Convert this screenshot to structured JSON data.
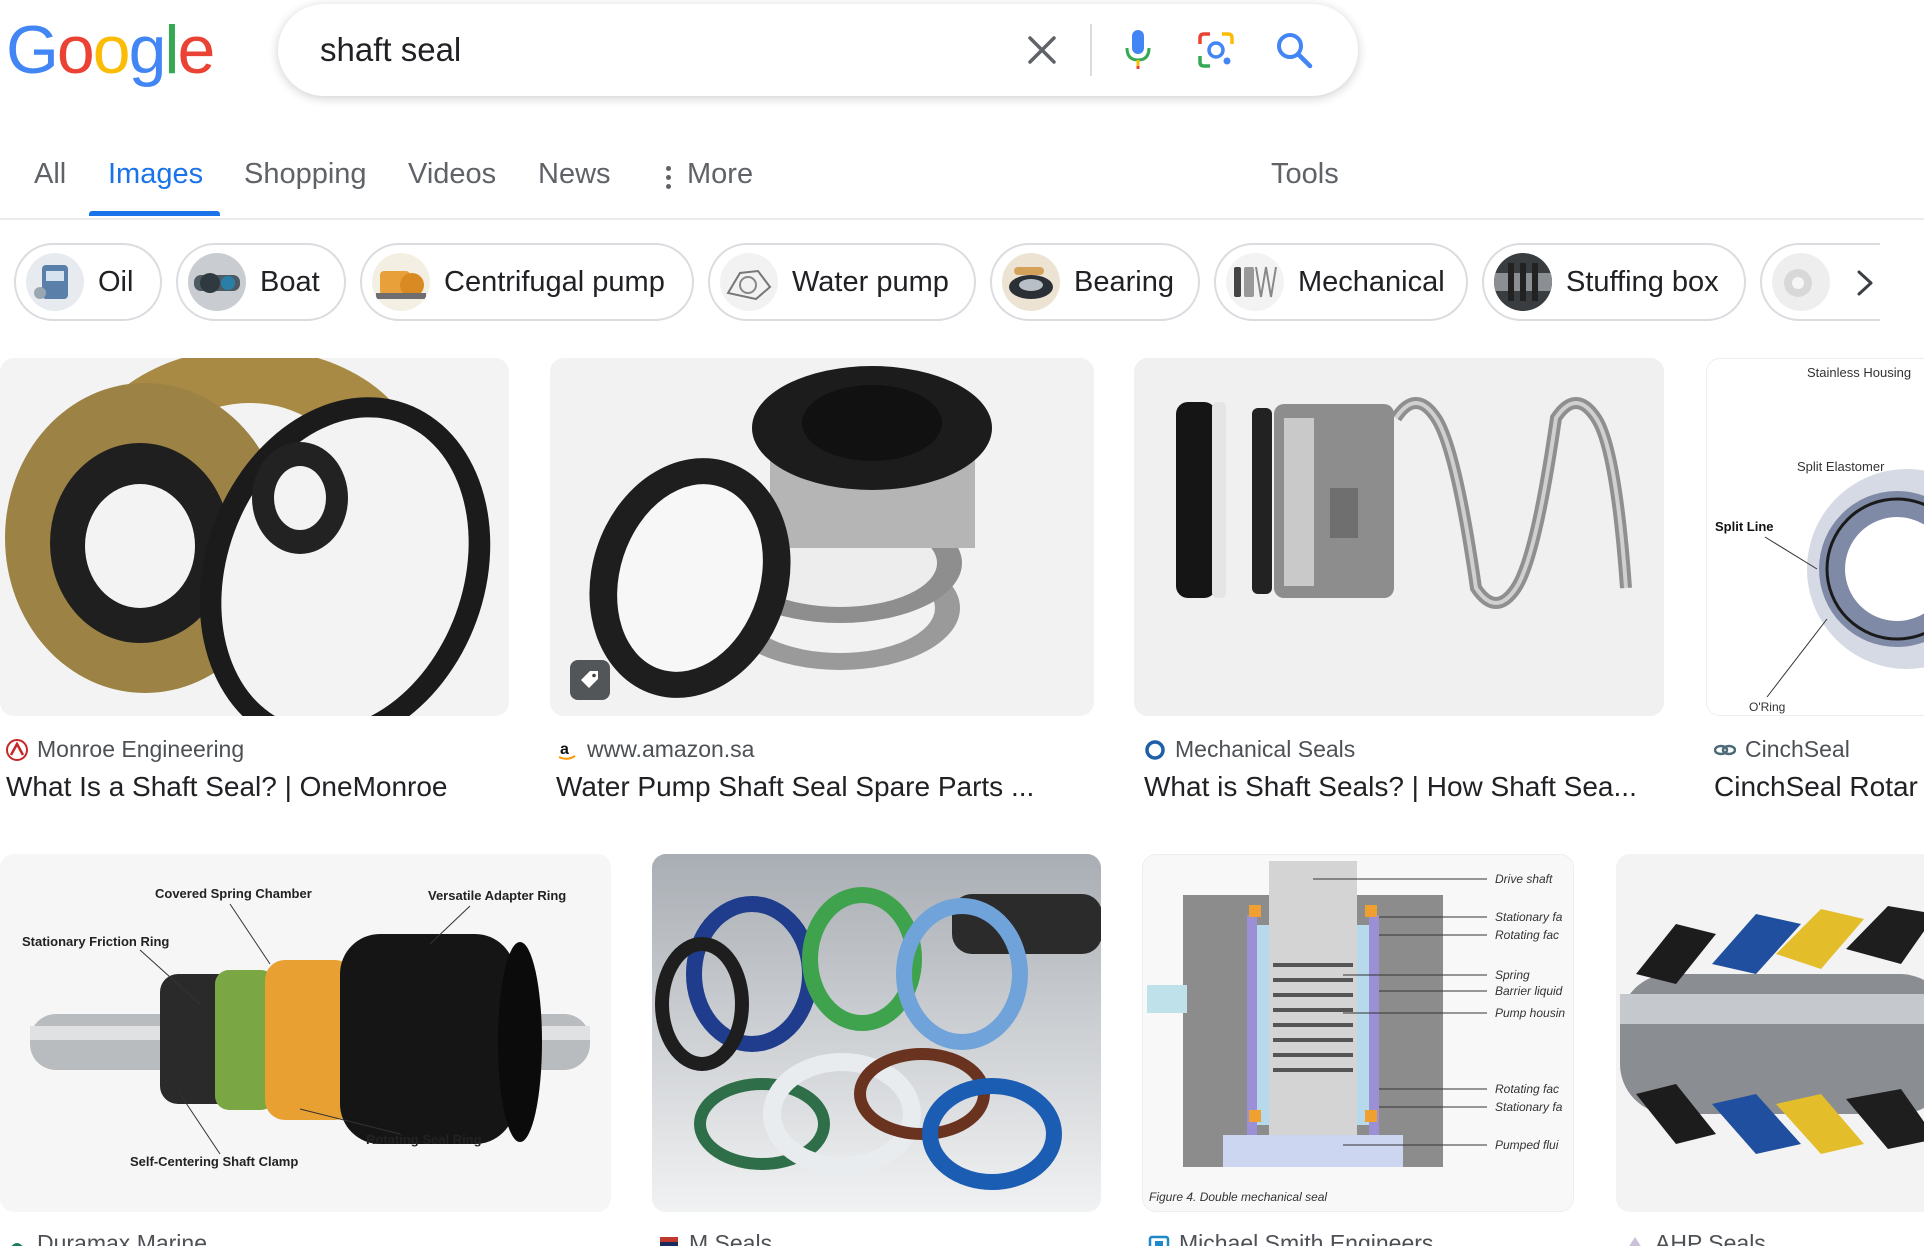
{
  "colors": {
    "blue": "#4285f4",
    "red": "#ea4335",
    "yellow": "#fbbc05",
    "green": "#34a853",
    "active_tab": "#1a73e8"
  },
  "logo": {
    "letters": [
      "G",
      "o",
      "o",
      "g",
      "l",
      "e"
    ]
  },
  "search": {
    "query": "shaft seal"
  },
  "header_icons": [
    "close-icon",
    "microphone-icon",
    "lens-camera-icon",
    "search-icon"
  ],
  "tabs": [
    {
      "label": "All",
      "active": false
    },
    {
      "label": "Images",
      "active": true
    },
    {
      "label": "Shopping",
      "active": false
    },
    {
      "label": "Videos",
      "active": false
    },
    {
      "label": "News",
      "active": false
    },
    {
      "label": "More",
      "active": false
    }
  ],
  "tools_label": "Tools",
  "chips": [
    {
      "label": "Oil"
    },
    {
      "label": "Boat"
    },
    {
      "label": "Centrifugal pump"
    },
    {
      "label": "Water pump"
    },
    {
      "label": "Bearing"
    },
    {
      "label": "Mechanical"
    },
    {
      "label": "Stuffing box"
    },
    {
      "label": ""
    }
  ],
  "results": [
    {
      "source": "Monroe Engineering",
      "title": "What Is a Shaft Seal? | OneMonroe"
    },
    {
      "source": "www.amazon.sa",
      "title": "Water Pump Shaft Seal Spare Parts ..."
    },
    {
      "source": "Mechanical Seals",
      "title": "What is Shaft Seals? | How Shaft Sea..."
    },
    {
      "source": "CinchSeal",
      "title": "CinchSeal Rotar"
    },
    {
      "source": "Duramax Marine",
      "title": ""
    },
    {
      "source": "M Seals",
      "title": ""
    },
    {
      "source": "Michael Smith Engineers",
      "title": ""
    },
    {
      "source": "AHP Seals",
      "title": ""
    }
  ],
  "image_labels": {
    "cinch": [
      "Stainless Housing",
      "Split Elastomer",
      "Split Line",
      "O'Ring"
    ],
    "duramax": [
      "Covered Spring Chamber",
      "Versatile Adapter Ring",
      "Stationary Friction Ring",
      "Rotating Seal Ring",
      "Self-Centering Shaft Clamp"
    ],
    "diagram": [
      "Drive shaft",
      "Stationary fa",
      "Rotating fac",
      "Spring",
      "Barrier liquid",
      "Pump housin",
      "Rotating fac",
      "Stationary fa",
      "Pumped flui",
      "Figure 4. Double mechanical seal"
    ]
  }
}
